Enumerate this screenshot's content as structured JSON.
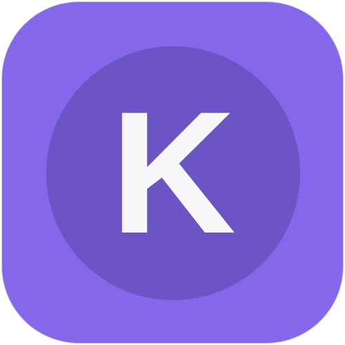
{
  "app_icon": {
    "letter": "K",
    "colors": {
      "background": "#8567ec",
      "circle": "#6b54c3",
      "letter": "#f7f7fa"
    }
  }
}
